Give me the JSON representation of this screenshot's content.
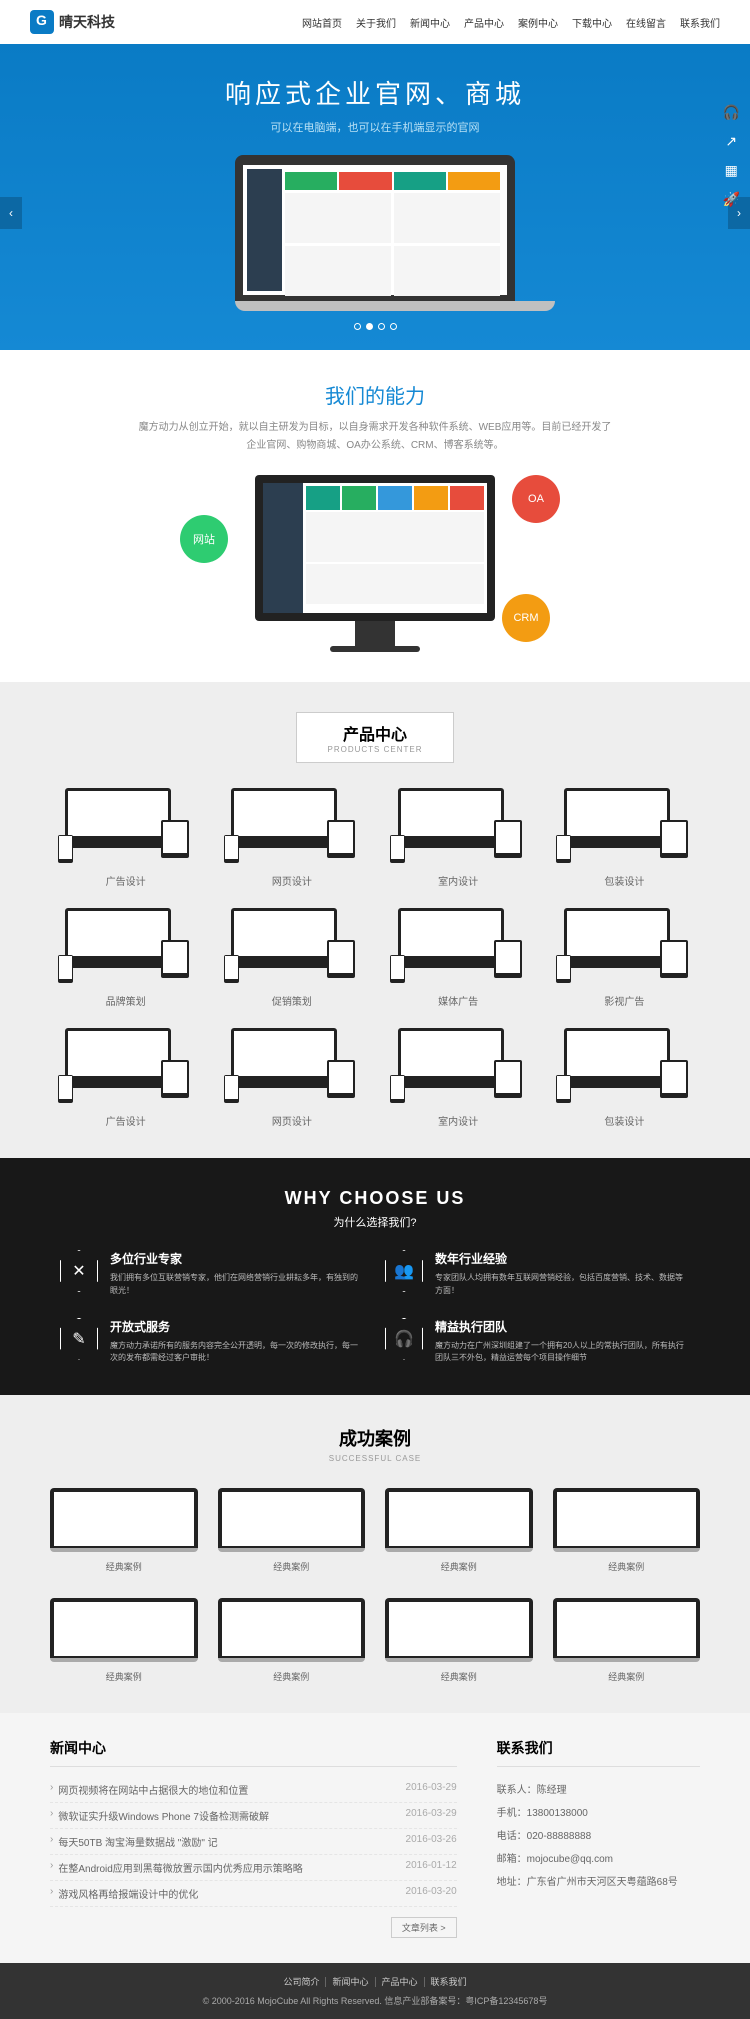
{
  "header": {
    "logo_text": "晴天科技",
    "nav": [
      "网站首页",
      "关于我们",
      "新闻中心",
      "产品中心",
      "案例中心",
      "下载中心",
      "在线留言",
      "联系我们"
    ]
  },
  "hero": {
    "title": "响应式企业官网、商城",
    "subtitle": "可以在电脑端，也可以在手机端显示的官网"
  },
  "ability": {
    "title": "我们的能力",
    "desc": "魔方动力从创立开始，就以自主研发为目标，以自身需求开发各种软件系统、WEB应用等。目前已经开发了企业官网、购物商城、OA办公系统、CRM、博客系统等。",
    "circles": {
      "web": "网站",
      "oa": "OA",
      "crm": "CRM"
    }
  },
  "products": {
    "title": "产品中心",
    "subtitle": "PRODUCTS CENTER",
    "items": [
      "广告设计",
      "网页设计",
      "室内设计",
      "包装设计",
      "品牌策划",
      "促销策划",
      "媒体广告",
      "影视广告",
      "广告设计",
      "网页设计",
      "室内设计",
      "包装设计"
    ]
  },
  "why": {
    "title": "WHY CHOOSE US",
    "subtitle": "为什么选择我们?",
    "items": [
      {
        "icon": "✕",
        "h": "多位行业专家",
        "p": "我们拥有多位互联营销专家，他们在网络营销行业耕耘多年，有独到的眼光！"
      },
      {
        "icon": "👥",
        "h": "数年行业经验",
        "p": "专家团队人均拥有数年互联网营销经验，包括百度营销、技术、数据等方面！"
      },
      {
        "icon": "✎",
        "h": "开放式服务",
        "p": "魔方动力承诺所有的服务内容完全公开透明，每一次的修改执行，每一次的发布都需经过客户审批！"
      },
      {
        "icon": "🎧",
        "h": "精益执行团队",
        "p": "魔方动力在广州深圳组建了一个拥有20人以上的常执行团队，所有执行团队三不外包，精益运营每个项目操作细节"
      }
    ]
  },
  "cases": {
    "title": "成功案例",
    "subtitle": "SUCCESSFUL CASE",
    "items": [
      "经典案例",
      "经典案例",
      "经典案例",
      "经典案例",
      "经典案例",
      "经典案例",
      "经典案例",
      "经典案例"
    ]
  },
  "news": {
    "title": "新闻中心",
    "items": [
      {
        "t": "网页视频将在网站中占据很大的地位和位置",
        "d": "2016-03-29"
      },
      {
        "t": "微软证实升级Windows Phone 7设备检测需破解",
        "d": "2016-03-29"
      },
      {
        "t": "每天50TB 淘宝海量数据战 \"激励\" 记",
        "d": "2016-03-26"
      },
      {
        "t": "在整Android应用到黑莓微放置示国内优秀应用示策略略",
        "d": "2016-01-12"
      },
      {
        "t": "游戏风格再给报端设计中的优化",
        "d": "2016-03-20"
      }
    ],
    "more": "文章列表 >"
  },
  "contact": {
    "title": "联系我们",
    "lines": [
      {
        "label": "联系人：",
        "val": "陈经理"
      },
      {
        "label": "手机：",
        "val": "13800138000"
      },
      {
        "label": "电话：",
        "val": "020-88888888"
      },
      {
        "label": "邮箱：",
        "val": "mojocube@qq.com"
      },
      {
        "label": "地址：",
        "val": "广东省广州市天河区天粤蕴路68号"
      }
    ]
  },
  "footer": {
    "links": [
      "公司简介",
      "新闻中心",
      "产品中心",
      "联系我们"
    ],
    "copyright": "© 2000-2016 MojoCube All Rights Reserved. 信息产业部备案号：粤ICP备12345678号"
  }
}
